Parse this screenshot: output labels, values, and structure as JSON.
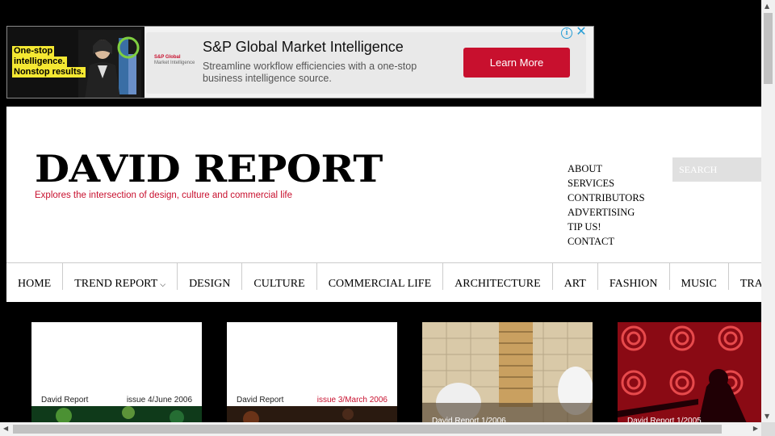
{
  "ad": {
    "left_lines": [
      "One-stop",
      "intelligence.",
      "Nonstop results."
    ],
    "logo_main": "S&P Global",
    "logo_sub": "Market Intelligence",
    "title": "S&P Global Market Intelligence",
    "description": "Streamline workflow efficiencies with a one-stop business intelligence source.",
    "cta_label": "Learn More",
    "info_glyph": "i",
    "close_glyph": "✕"
  },
  "site": {
    "logo": "DAVID REPORT",
    "tagline": "Explores the intersection of design, culture and commercial life"
  },
  "top_links": [
    "ABOUT",
    "SERVICES",
    "CONTRIBUTORS",
    "ADVERTISING",
    "TIP US!",
    "CONTACT"
  ],
  "search": {
    "placeholder": "SEARCH"
  },
  "nav": [
    {
      "label": "HOME"
    },
    {
      "label": "TREND REPORT",
      "dropdown": true
    },
    {
      "label": "DESIGN"
    },
    {
      "label": "CULTURE"
    },
    {
      "label": "COMMERCIAL LIFE"
    },
    {
      "label": "ARCHITECTURE"
    },
    {
      "label": "ART"
    },
    {
      "label": "FASHION"
    },
    {
      "label": "MUSIC"
    },
    {
      "label": "TRAVEL"
    }
  ],
  "thumbnails": [
    {
      "caption": "David Report",
      "issue": "issue 4/June 2006",
      "issue_color": "#222222"
    },
    {
      "caption": "David Report",
      "issue": "issue 3/March 2006",
      "issue_color": "#c8102e"
    },
    {
      "caption": "David Report 1/2006"
    },
    {
      "caption": "David Report 1/2005"
    }
  ],
  "colors": {
    "accent": "#c8102e",
    "page_bg": "#000000",
    "ad_button": "#c8102e"
  }
}
